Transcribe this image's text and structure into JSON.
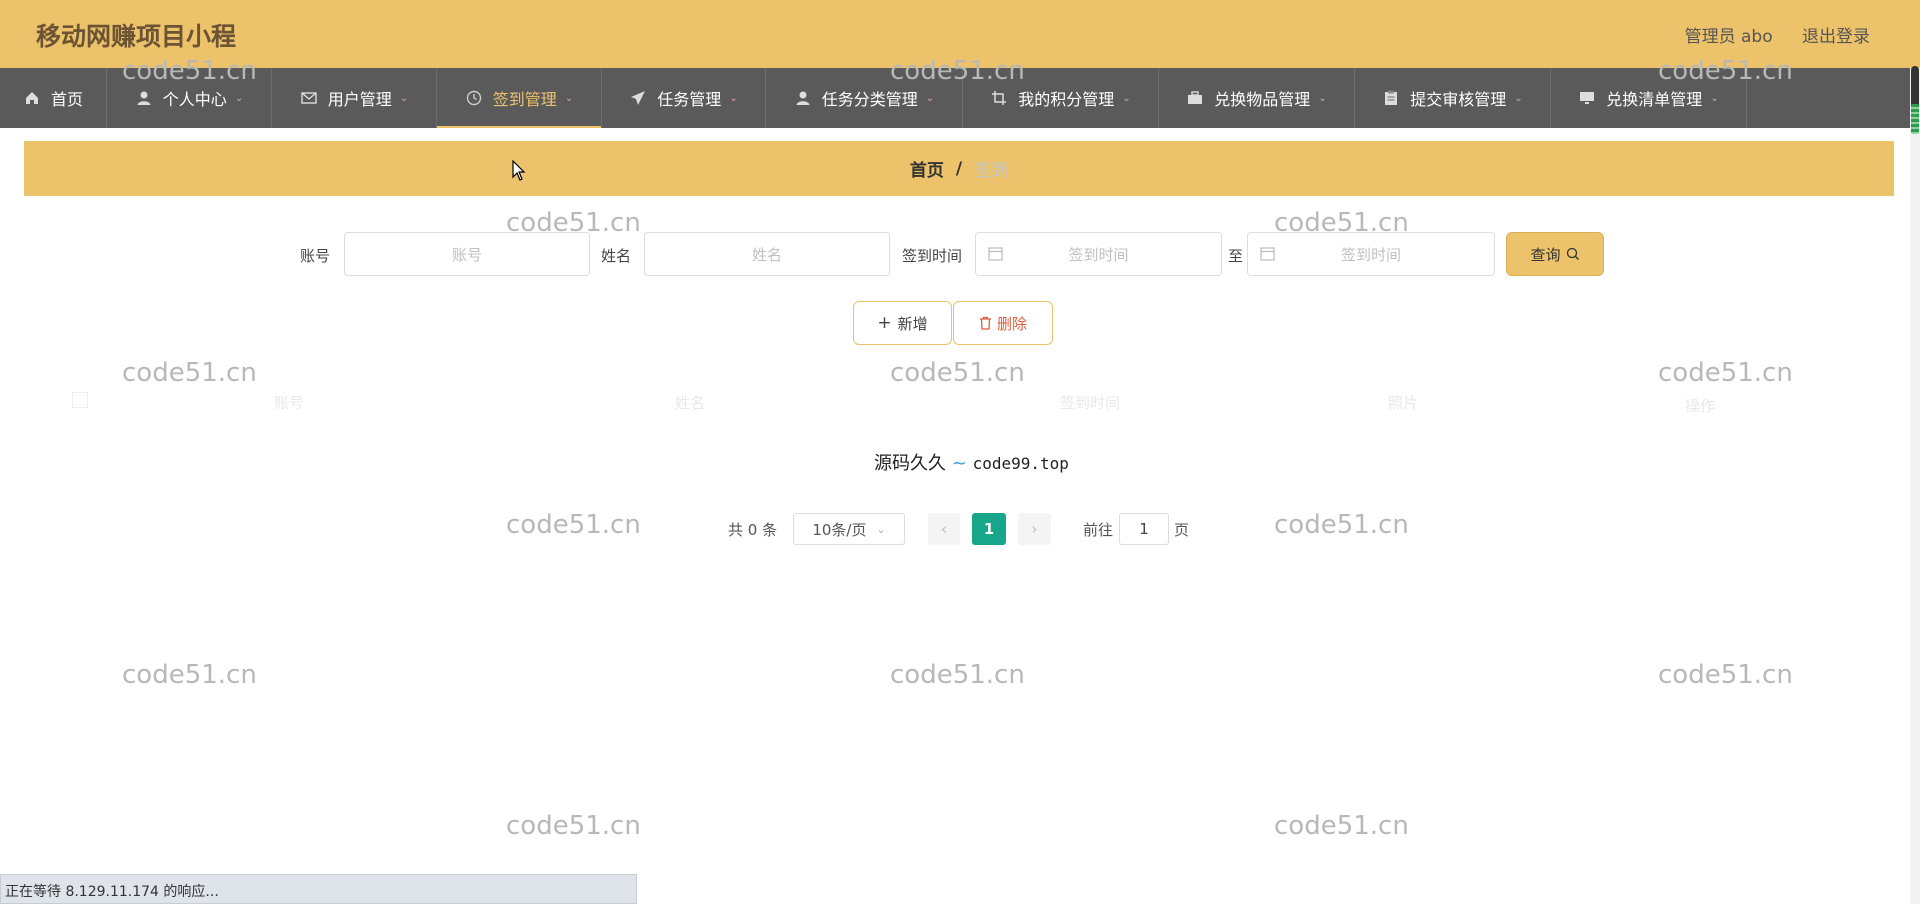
{
  "header": {
    "title": "移动网赚项目小程",
    "user_label": "管理员 abo",
    "logout_label": "退出登录"
  },
  "nav": {
    "items": [
      {
        "label": "首页",
        "icon": "home-icon",
        "has_caret": false,
        "active": false
      },
      {
        "label": "个人中心",
        "icon": "person-icon",
        "has_caret": true,
        "active": false
      },
      {
        "label": "用户管理",
        "icon": "mail-icon",
        "has_caret": true,
        "active": false
      },
      {
        "label": "签到管理",
        "icon": "clock-icon",
        "has_caret": true,
        "active": true
      },
      {
        "label": "任务管理",
        "icon": "send-icon",
        "has_caret": true,
        "active": false
      },
      {
        "label": "任务分类管理",
        "icon": "person-icon",
        "has_caret": true,
        "active": false
      },
      {
        "label": "我的积分管理",
        "icon": "crop-icon",
        "has_caret": true,
        "active": false
      },
      {
        "label": "兑换物品管理",
        "icon": "briefcase-icon",
        "has_caret": true,
        "active": false
      },
      {
        "label": "提交审核管理",
        "icon": "clipboard-icon",
        "has_caret": true,
        "active": false
      },
      {
        "label": "兑换清单管理",
        "icon": "monitor-icon",
        "has_caret": true,
        "active": false
      }
    ]
  },
  "breadcrumb": {
    "home": "首页",
    "separator": "/",
    "current": "签到"
  },
  "search": {
    "account_label": "账号",
    "account_placeholder": "账号",
    "name_label": "姓名",
    "name_placeholder": "姓名",
    "time_label": "签到时间",
    "time_start_placeholder": "签到时间",
    "to_label": "至",
    "time_end_placeholder": "签到时间",
    "query_label": "查询"
  },
  "actions": {
    "add_label": "新增",
    "delete_label": "删除"
  },
  "table": {
    "headers": [
      "账号",
      "姓名",
      "签到时间",
      "照片",
      "操作"
    ]
  },
  "empty": {
    "text_cn": "源码久久",
    "text_en": "code99.top"
  },
  "pagination": {
    "total": "共 0 条",
    "page_size": "10条/页",
    "current_page": "1",
    "goto_label": "前往",
    "goto_value": "1",
    "page_unit": "页"
  },
  "watermark": "code51.cn",
  "status_bar": "正在等待 8.129.11.174 的响应..."
}
